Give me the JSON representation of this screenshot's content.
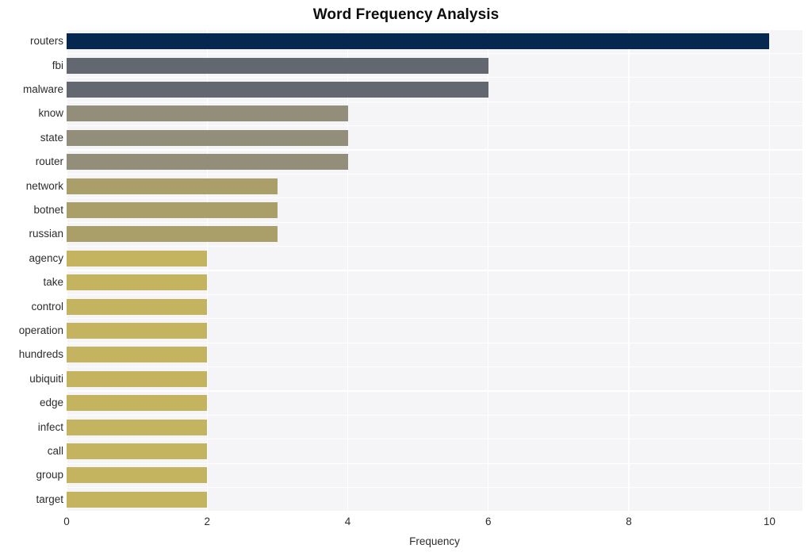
{
  "chart_data": {
    "type": "bar",
    "orientation": "horizontal",
    "title": "Word Frequency Analysis",
    "xlabel": "Frequency",
    "ylabel": "",
    "xlim": [
      0,
      10.47
    ],
    "ylim": [
      0,
      20
    ],
    "grid": true,
    "legend": null,
    "xticks": [
      "0",
      "2",
      "4",
      "6",
      "8",
      "10"
    ],
    "xtick_values": [
      0,
      2,
      4,
      6,
      8,
      10
    ],
    "categories": [
      "routers",
      "fbi",
      "malware",
      "know",
      "state",
      "router",
      "network",
      "botnet",
      "russian",
      "agency",
      "take",
      "control",
      "operation",
      "hundreds",
      "ubiquiti",
      "edge",
      "infect",
      "call",
      "group",
      "target"
    ],
    "values": [
      10,
      6,
      6,
      4,
      4,
      4,
      3,
      3,
      3,
      2,
      2,
      2,
      2,
      2,
      2,
      2,
      2,
      2,
      2,
      2
    ],
    "bar_colors": [
      "#062850",
      "#63676f",
      "#63676f",
      "#928e79",
      "#928e79",
      "#928e79",
      "#aa9f69",
      "#aa9f69",
      "#aa9f69",
      "#c5b45f",
      "#c5b45f",
      "#c5b45f",
      "#c5b45f",
      "#c5b45f",
      "#c5b45f",
      "#c5b45f",
      "#c5b45f",
      "#c5b45f",
      "#c5b45f",
      "#c5b45f"
    ],
    "plot_background": "#f5f5f7",
    "grid_color": "#ffffff",
    "figure_background": "#ffffff",
    "text_color": "#2c2c2c",
    "title_color": "#0d0d0d"
  }
}
